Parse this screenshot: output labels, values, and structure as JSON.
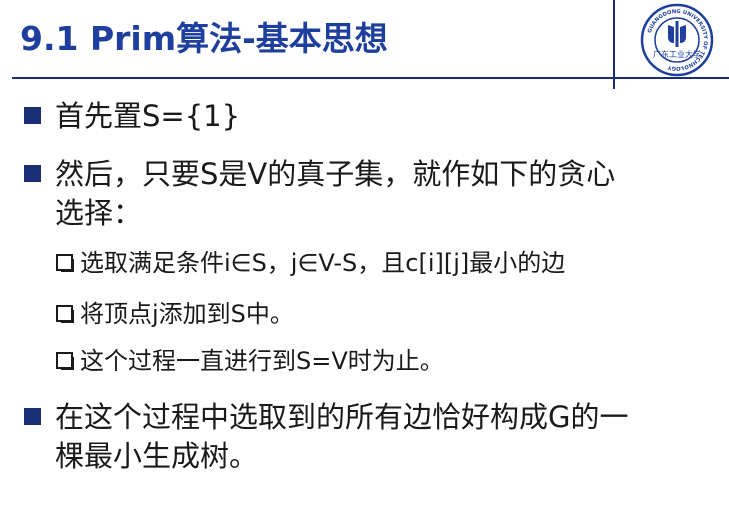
{
  "slide": {
    "title": "9.1 Prim算法-基本思想",
    "bullets": [
      {
        "text": "首先置S={1}"
      },
      {
        "line1": "然后，只要S是V的真子集，就作如下的贪心",
        "line2": "选择："
      },
      {
        "line1": "在这个过程中选取到的所有边恰好构成G的一",
        "line2": "棵最小生成树。"
      }
    ],
    "subbullets": [
      "选取满足条件i∈S，j∈V-S，且c[i][j]最小的边",
      "将顶点j添加到S中。",
      "这个过程一直进行到S=V时为止。"
    ]
  },
  "logo": {
    "ring_text": "GUANGDONG UNIVERSITY OF TECHNOLOGY",
    "script_text": "广东工业大学",
    "color": "#1f3f9f"
  }
}
